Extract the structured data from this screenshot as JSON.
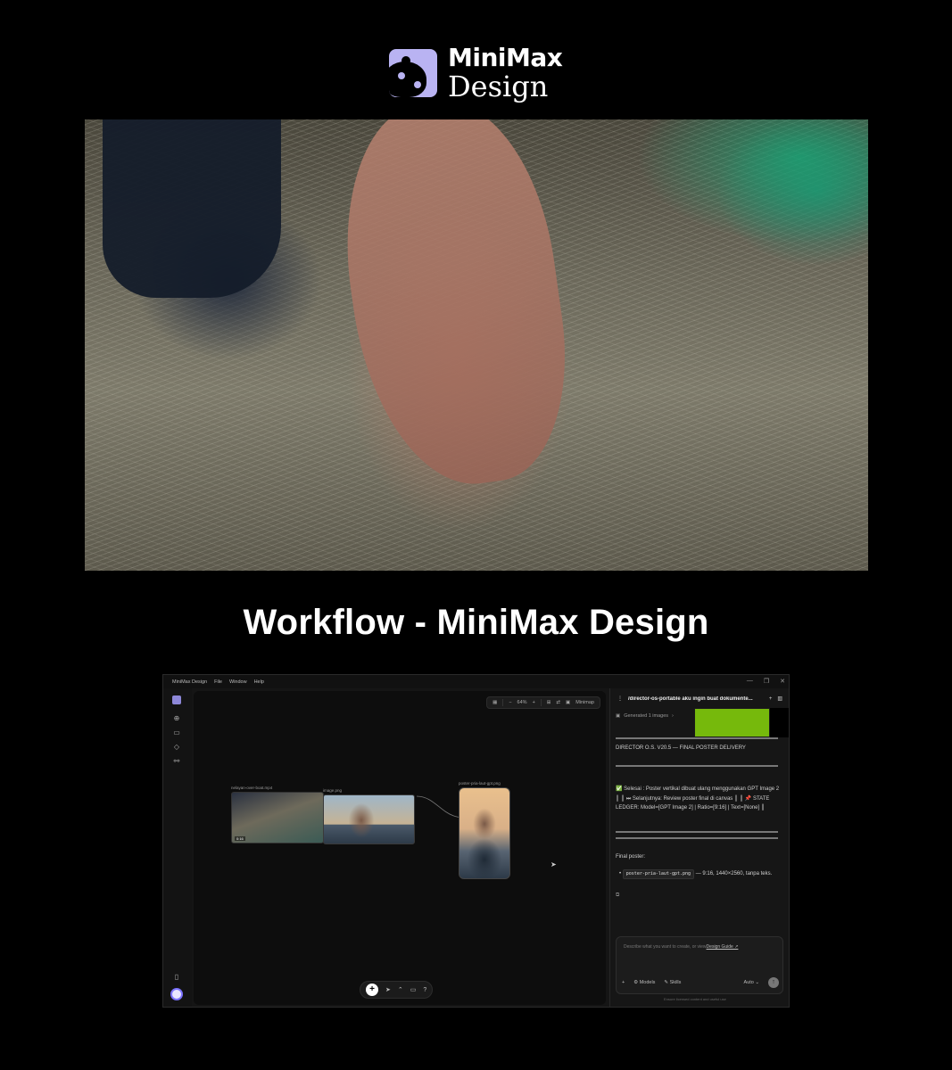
{
  "logo": {
    "line1": "MiniMax",
    "line2": "Design"
  },
  "heading": "Workflow - MiniMax Design",
  "app": {
    "title": "MiniMax Design",
    "menu": [
      "File",
      "Window",
      "Help"
    ],
    "window_controls": [
      "—",
      "❐",
      "✕"
    ],
    "rail_icons": [
      "plus-icon",
      "folder-icon",
      "cube-icon",
      "shapes-icon"
    ],
    "toolbar": {
      "zoom": "64%",
      "minus": "−",
      "plus": "+",
      "minimap": "Minimap"
    },
    "nodes": {
      "video": {
        "label": "nelayan-over-boat.mp4",
        "duration": "0:16"
      },
      "image": {
        "label": "image.png"
      },
      "poster": {
        "label": "poster-pria-laut-gpt.png"
      }
    },
    "bottom_tools": [
      "+",
      "➤",
      "⌃",
      "▭",
      "?"
    ],
    "panel": {
      "title": "/director-os-portable aku ingin buat dokumente...",
      "generated": "Generated 1 images",
      "director_line": "DIRECTOR O.S. V20.5 — FINAL POSTER DELIVERY",
      "done_line": "✅ Selesai : Poster vertikal dibuat ulang menggunakan GPT Image 2 ║ ║ ⏭ Selanjutnya: Review poster final di canvas ║ ║ 📌 STATE LEDGER: Model=[GPT Image 2] | Ratio=[9:16] | Text=[None] ║",
      "final_label": "Final poster:",
      "file_pill": "poster-pria-laut-gpt.png",
      "file_desc": "— 9:16, 1440×2560, tanpa teks.",
      "composer_placeholder": "Describe what you want to create, or view",
      "composer_link": "Design Guide ↗",
      "models": "Models",
      "skills": "Skills",
      "auto": "Auto",
      "footnote": "Ensure licensed content and useful use"
    }
  },
  "colors": {
    "accent": "#76b90c",
    "logo": "#b9b3f2"
  }
}
